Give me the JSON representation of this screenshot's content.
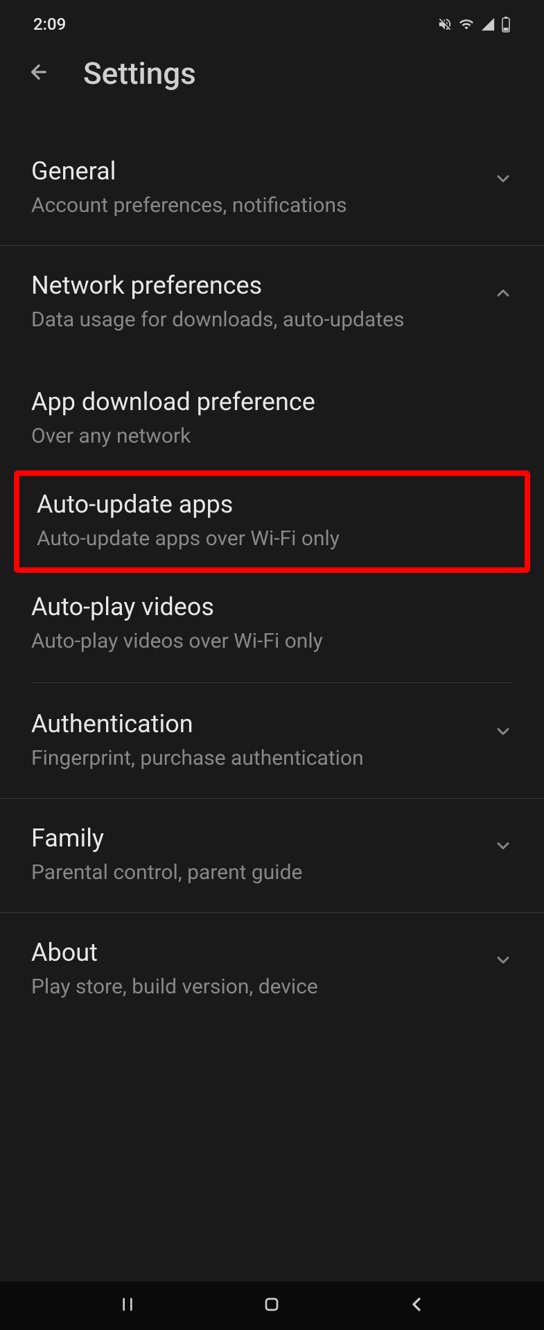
{
  "status_bar": {
    "time": "2:09"
  },
  "header": {
    "title": "Settings"
  },
  "sections": {
    "general": {
      "title": "General",
      "subtitle": "Account preferences, notifications"
    },
    "network": {
      "title": "Network preferences",
      "subtitle": "Data usage for downloads, auto-updates",
      "items": {
        "download_pref": {
          "title": "App download preference",
          "subtitle": "Over any network"
        },
        "auto_update": {
          "title": "Auto-update apps",
          "subtitle": "Auto-update apps over Wi-Fi only"
        },
        "auto_play": {
          "title": "Auto-play videos",
          "subtitle": "Auto-play videos over Wi-Fi only"
        }
      }
    },
    "authentication": {
      "title": "Authentication",
      "subtitle": "Fingerprint, purchase authentication"
    },
    "family": {
      "title": "Family",
      "subtitle": "Parental control, parent guide"
    },
    "about": {
      "title": "About",
      "subtitle": "Play store, build version, device"
    }
  }
}
